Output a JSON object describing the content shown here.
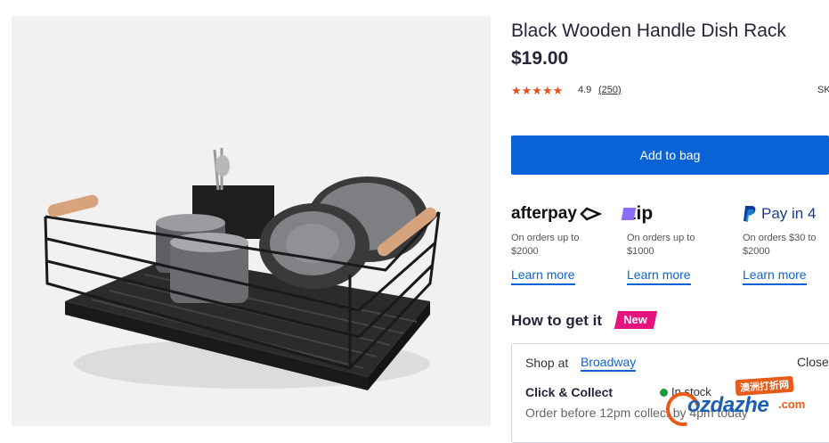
{
  "product": {
    "title": "Black Wooden Handle Dish Rack",
    "price": "$19.00",
    "stars": "★★★★★",
    "rating": "4.9",
    "reviews": "(250)",
    "sku_label": "SK",
    "add_button": "Add to bag"
  },
  "payments": [
    {
      "logo": "afterpay",
      "desc": "On orders up to $2000",
      "link": "Learn more"
    },
    {
      "logo": "zip",
      "desc": "On orders up to $1000",
      "link": "Learn more"
    },
    {
      "logo": "Pay in 4",
      "desc": "On orders $30 to $2000",
      "link": "Learn more"
    }
  ],
  "delivery": {
    "heading": "How to get it",
    "badge": "New",
    "shop_at": "Shop at",
    "store": "Broadway",
    "close": "Close",
    "method": "Click & Collect",
    "stock": "In stock",
    "note": "Order before 12pm collect by 4pm today"
  },
  "watermark": {
    "badge": "澳洲打折网",
    "text": "ozdazhe",
    "suffix": ".com"
  },
  "colors": {
    "accent": "#0a63d6",
    "star": "#e2521e",
    "badge": "#e5137e",
    "in_stock": "#1a9a3a"
  }
}
